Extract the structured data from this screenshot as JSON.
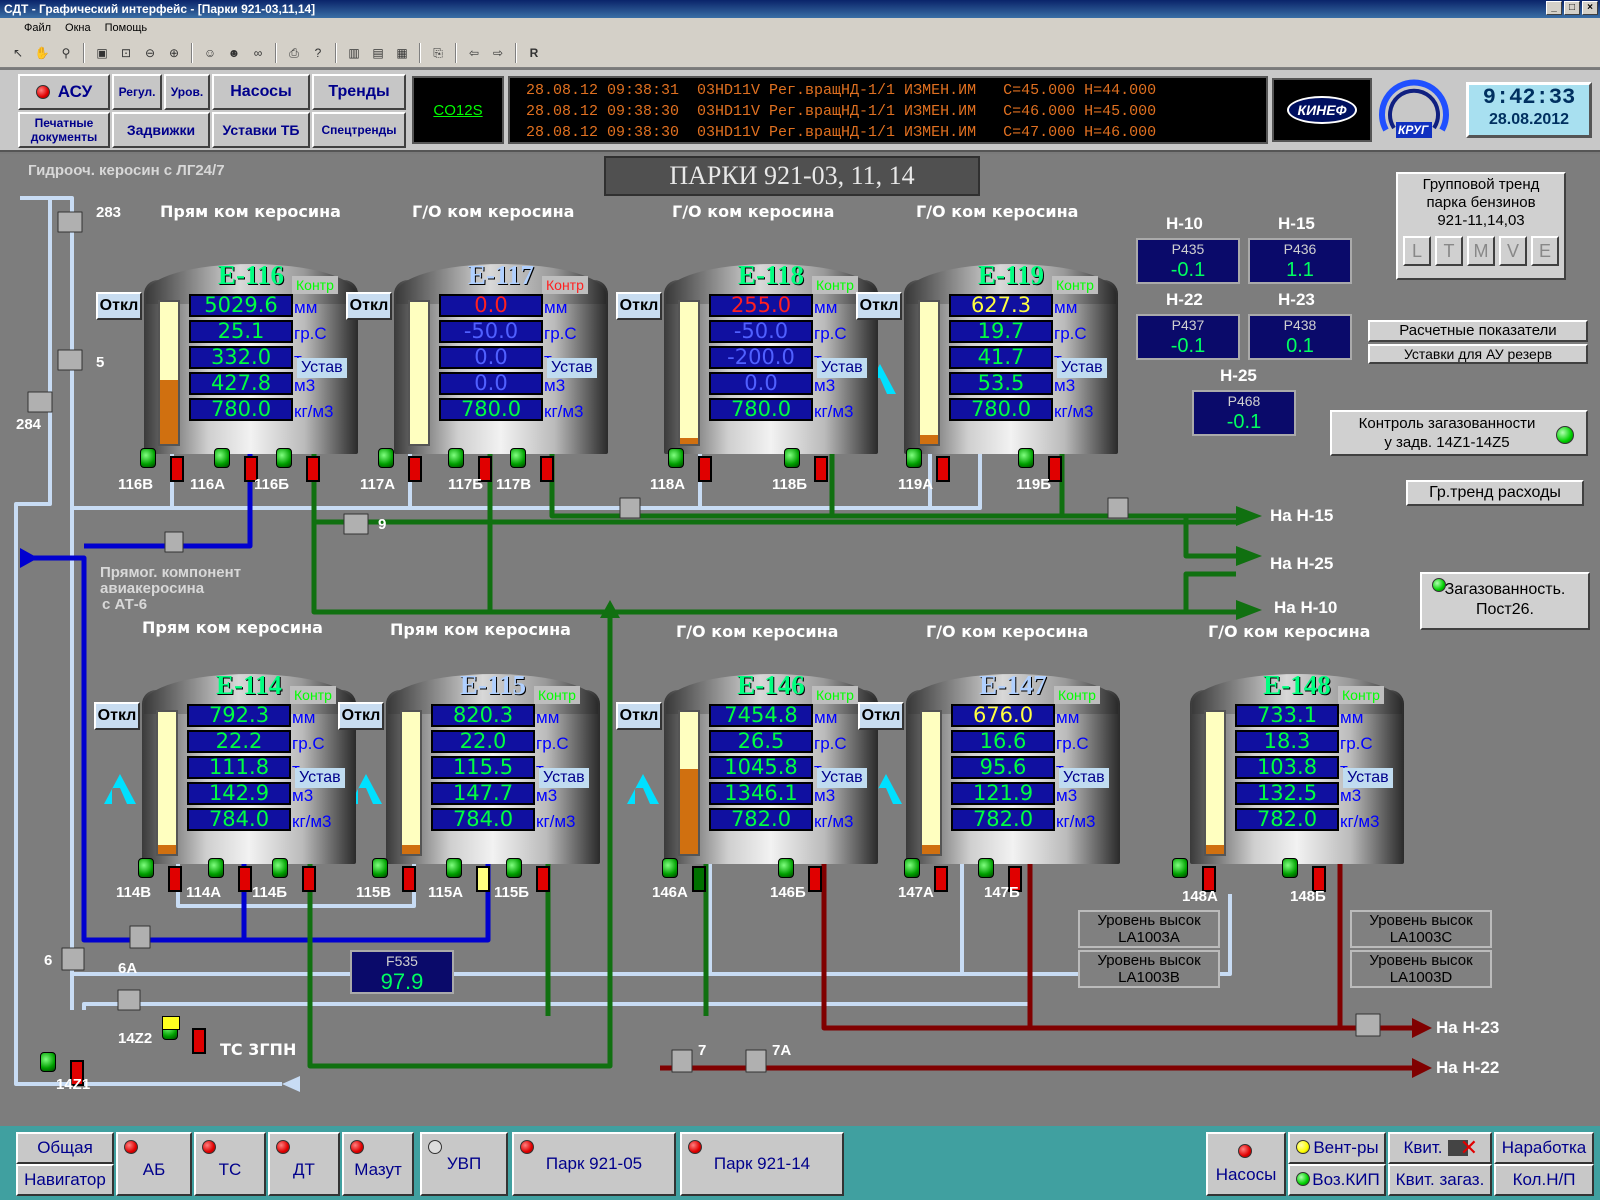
{
  "window": {
    "title": "СДТ - Графический интерфейс - [Парки 921-03,11,14]",
    "controls": [
      "_",
      "□",
      "×"
    ]
  },
  "menu": [
    "Файл",
    "Окна",
    "Помощь"
  ],
  "toolbar_icons": [
    "pointer-icon",
    "hand-icon",
    "magnifier-icon",
    "one-to-one-icon",
    "zoom-fit-icon",
    "zoom-out-icon",
    "zoom-in-icon",
    "users-icon",
    "dual-users-icon",
    "binoculars-icon",
    "print-icon",
    "help-icon",
    "layout-1-icon",
    "layout-2-icon",
    "layout-3-icon",
    "export-icon",
    "back-arrow-icon",
    "forward-arrow-icon",
    "r-icon"
  ],
  "toolbar_r": "R",
  "nav": {
    "asu": "АСУ",
    "regul": "Регул.",
    "urov": "Уров.",
    "nasosy": "Насосы",
    "trendy": "Тренды",
    "print_docs": "Печатные документы",
    "zadvizhki": "Задвижки",
    "ustavki_tb": "Уставки ТБ",
    "spectrendy": "Спецтренды",
    "code": "CO12S"
  },
  "alarms": [
    "28.08.12 09:38:31  03HD11V Рег.вращНД-1/1 ИЗМЕН.ИМ   С=45.000 Н=44.000",
    "28.08.12 09:38:30  03HD11V Рег.вращНД-1/1 ИЗМЕН.ИМ   С=46.000 Н=45.000",
    "28.08.12 09:38:30  03HD11V Рег.вращНД-1/1 ИЗМЕН.ИМ   С=47.000 Н=46.000"
  ],
  "logos": {
    "kinef": "КИНЕФ",
    "krug": "КРУГ"
  },
  "clock": {
    "time": "9:42:33",
    "date": "28.08.2012"
  },
  "page_title": "ПАРКИ 921-03, 11, 14",
  "labels": {
    "hydro": "Гидрооч. керосин с ЛГ24/7",
    "pryam_at6_1": "Прямог. компонент",
    "pryam_at6_2": "авиакеросина",
    "pryam_at6_3": "с АТ-6",
    "ts3gpn": "ТС 3ГПН"
  },
  "units": [
    "мм",
    "гр.С",
    "т",
    "м3",
    "кг/м3"
  ],
  "kontr": "Контр",
  "ustav": "Устав",
  "otkl": "Откл",
  "tanks": [
    {
      "id": "e116",
      "name": "Е-116",
      "caption": "Прям ком керосина",
      "values": [
        "5029.6",
        "25.1",
        "332.0",
        "427.8",
        "780.0"
      ],
      "fill": 0.45,
      "kontr_red": false,
      "blue": false
    },
    {
      "id": "e117",
      "name": "Е-117",
      "caption": "Г/О ком керосина",
      "values": [
        "0.0",
        "-50.0",
        "0.0",
        "0.0",
        "780.0"
      ],
      "fill": 0,
      "kontr_red": true,
      "blue": true
    },
    {
      "id": "e118",
      "name": "Е-118",
      "caption": "Г/О ком керосина",
      "values": [
        "255.0",
        "-50.0",
        "-200.0",
        "0.0",
        "780.0"
      ],
      "fill": 0.04,
      "kontr_red": false,
      "blue": false
    },
    {
      "id": "e119",
      "name": "Е-119",
      "caption": "Г/О ком керосина",
      "values": [
        "627.3",
        "19.7",
        "41.7",
        "53.5",
        "780.0"
      ],
      "fill": 0.06,
      "kontr_red": false,
      "blue": false
    },
    {
      "id": "e114",
      "name": "Е-114",
      "caption": "Прям ком керосина",
      "values": [
        "792.3",
        "22.2",
        "111.8",
        "142.9",
        "784.0"
      ],
      "fill": 0.06,
      "kontr_red": false,
      "blue": false
    },
    {
      "id": "e115",
      "name": "Е-115",
      "caption": "Прям ком керосина",
      "values": [
        "820.3",
        "22.0",
        "115.5",
        "147.7",
        "784.0"
      ],
      "fill": 0.06,
      "kontr_red": false,
      "blue": true
    },
    {
      "id": "e146",
      "name": "Е-146",
      "caption": "Г/О ком керосина",
      "values": [
        "7454.8",
        "26.5",
        "1045.8",
        "1346.1",
        "782.0"
      ],
      "fill": 0.6,
      "kontr_red": false,
      "blue": false
    },
    {
      "id": "e147",
      "name": "Е-147",
      "caption": "Г/О ком керосина",
      "values": [
        "676.0",
        "16.6",
        "95.6",
        "121.9",
        "782.0"
      ],
      "fill": 0.06,
      "kontr_red": false,
      "blue": true
    },
    {
      "id": "e148",
      "name": "Е-148",
      "caption": "Г/О ком керосина",
      "values": [
        "733.1",
        "18.3",
        "103.8",
        "132.5",
        "782.0"
      ],
      "fill": 0.06,
      "kontr_red": false,
      "blue": false
    }
  ],
  "valves": [
    "116В",
    "116А",
    "116Б",
    "117А",
    "117Б",
    "117В",
    "118А",
    "118Б",
    "119А",
    "119Б",
    "114В",
    "114А",
    "114Б",
    "115В",
    "115А",
    "115Б",
    "146А",
    "146Б",
    "147А",
    "147Б",
    "148А",
    "148Б",
    "283",
    "5",
    "284",
    "9",
    "6",
    "6А",
    "7",
    "7А",
    "14Z2",
    "14Z1"
  ],
  "pressure": [
    {
      "h": "Н-10",
      "code": "P435",
      "val": "-0.1"
    },
    {
      "h": "Н-15",
      "code": "P436",
      "val": "1.1"
    },
    {
      "h": "Н-22",
      "code": "P437",
      "val": "-0.1"
    },
    {
      "h": "Н-23",
      "code": "P438",
      "val": "0.1"
    },
    {
      "h": "Н-25",
      "code": "P468",
      "val": "-0.1"
    }
  ],
  "flow": {
    "code": "F535",
    "val": "97.9"
  },
  "group_trend": {
    "l1": "Групповой тренд",
    "l2": "парка бензинов",
    "l3": "921-11,14,03",
    "buttons": [
      "L",
      "T",
      "M",
      "V",
      "E"
    ]
  },
  "right_buttons": {
    "raschet": "Расчетные показатели",
    "ustavki_au": "Уставки для АУ резерв",
    "gaz_l1": "Контроль загазованности",
    "gaz_l2": "у задв. 14Z1-14Z5",
    "grtrend": "Гр.тренд расходы",
    "post_l1": "Загазованность.",
    "post_l2": "Пост26."
  },
  "destinations": [
    "На Н-15",
    "На Н-25",
    "На Н-10",
    "На Н-23",
    "На Н-22"
  ],
  "level_alarms": [
    [
      "Уровень высок",
      "LA1003A"
    ],
    [
      "Уровень высок",
      "LA1003B"
    ],
    [
      "Уровень высок",
      "LA1003C"
    ],
    [
      "Уровень высок",
      "LA1003D"
    ]
  ],
  "bottom": {
    "obshaya": "Общая",
    "navigator": "Навигатор",
    "ab": "АБ",
    "ts": "ТС",
    "dt": "ДТ",
    "mazut": "Мазут",
    "uvp": "УВП",
    "park05": "Парк 921-05",
    "park14": "Парк 921-14",
    "nasosy": "Насосы",
    "ventry": "Вент-ры",
    "kvit": "Квит.",
    "narabotka": "Наработка",
    "vozkip": "Воз.КИП",
    "kvit_zagaz": "Квит. загаз.",
    "kol_np": "Кол.Н/П"
  },
  "colors": {
    "pipe_light": "#b8d4f0",
    "pipe_green": "#107010",
    "pipe_blue": "#0000d0",
    "pipe_red": "#800000",
    "value_bg": "#1010a0",
    "value_fg": "#00ff40"
  }
}
